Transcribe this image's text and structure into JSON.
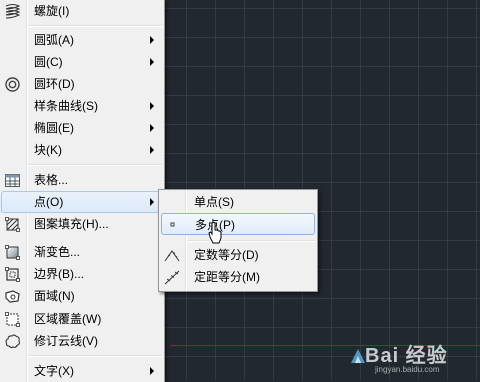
{
  "menu": {
    "items": [
      {
        "label": "螺旋(I)",
        "icon": "helix-icon",
        "submenu": false
      },
      {
        "label": "圆弧(A)",
        "icon": "",
        "submenu": true
      },
      {
        "label": "圆(C)",
        "icon": "",
        "submenu": true
      },
      {
        "label": "圆环(D)",
        "icon": "donut-icon",
        "submenu": false
      },
      {
        "label": "样条曲线(S)",
        "icon": "",
        "submenu": true
      },
      {
        "label": "椭圆(E)",
        "icon": "",
        "submenu": true
      },
      {
        "label": "块(K)",
        "icon": "",
        "submenu": true
      },
      {
        "label": "表格...",
        "icon": "table-icon",
        "submenu": false
      },
      {
        "label": "点(O)",
        "icon": "",
        "submenu": true
      },
      {
        "label": "图案填充(H)...",
        "icon": "hatch-icon",
        "submenu": false
      },
      {
        "label": "渐变色...",
        "icon": "gradient-icon",
        "submenu": false
      },
      {
        "label": "边界(B)...",
        "icon": "boundary-icon",
        "submenu": false
      },
      {
        "label": "面域(N)",
        "icon": "region-icon",
        "submenu": false
      },
      {
        "label": "区域覆盖(W)",
        "icon": "wipeout-icon",
        "submenu": false
      },
      {
        "label": "修订云线(V)",
        "icon": "revcloud-icon",
        "submenu": false
      },
      {
        "label": "文字(X)",
        "icon": "",
        "submenu": true
      }
    ]
  },
  "submenu": {
    "items": [
      {
        "label": "单点(S)",
        "icon": ""
      },
      {
        "label": "多点(P)",
        "icon": "multiple-points-icon"
      },
      {
        "label": "定数等分(D)",
        "icon": "divide-icon"
      },
      {
        "label": "定距等分(M)",
        "icon": "measure-icon"
      }
    ]
  },
  "watermark": {
    "text": "Bai 经验",
    "url": "jingyan.baidu.com"
  },
  "colors": {
    "canvas": "#212830",
    "menu_bg": "#f0f0f0",
    "highlight_border": "#8db2e3"
  }
}
